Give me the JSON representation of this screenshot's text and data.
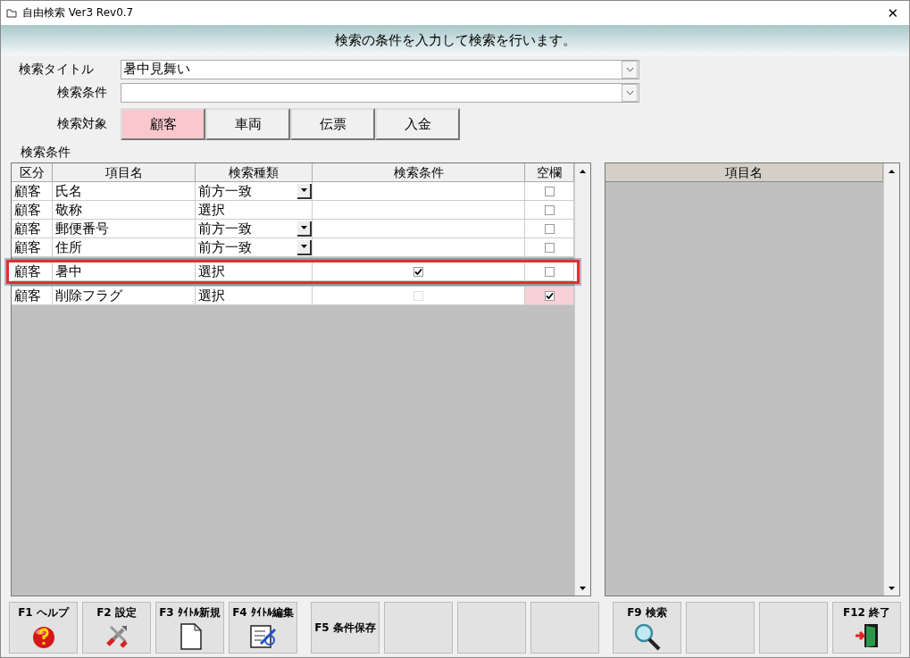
{
  "window": {
    "title": "自由検索 Ver3 Rev0.7",
    "close": "✕"
  },
  "banner": "検索の条件を入力して検索を行います。",
  "form": {
    "title_label": "検索タイトル",
    "title_value": "暑中見舞い",
    "condition_label": "検索条件",
    "target_label": "検索対象"
  },
  "targets": [
    {
      "label": "顧客",
      "selected": true
    },
    {
      "label": "車両",
      "selected": false
    },
    {
      "label": "伝票",
      "selected": false
    },
    {
      "label": "入金",
      "selected": false
    }
  ],
  "grid_label": "検索条件",
  "grid": {
    "columns": [
      "区分",
      "項目名",
      "検索種類",
      "検索条件",
      "空欄"
    ],
    "rows": [
      {
        "kind": "text",
        "category": "顧客",
        "item": "氏名",
        "type": "前方一致",
        "dropdown": true,
        "blank_checked": false,
        "highlighted": false
      },
      {
        "kind": "plain",
        "category": "顧客",
        "item": "敬称",
        "type": "選択",
        "dropdown": false,
        "blank_checked": false,
        "highlighted": false
      },
      {
        "kind": "text",
        "category": "顧客",
        "item": "郵便番号",
        "type": "前方一致",
        "dropdown": true,
        "blank_checked": false,
        "highlighted": false
      },
      {
        "kind": "text",
        "category": "顧客",
        "item": "住所",
        "type": "前方一致",
        "dropdown": true,
        "blank_checked": false,
        "highlighted": false
      },
      {
        "kind": "checkbox",
        "category": "顧客",
        "item": "暑中",
        "type": "選択",
        "dropdown": false,
        "condition_checked": true,
        "condition_disabled": false,
        "blank_checked": false,
        "highlighted": true
      },
      {
        "kind": "checkbox",
        "category": "顧客",
        "item": "削除フラグ",
        "type": "選択",
        "dropdown": false,
        "condition_checked": false,
        "condition_disabled": true,
        "blank_checked": true,
        "highlighted": false
      }
    ]
  },
  "side_panel": {
    "column": "項目名"
  },
  "function_keys": [
    {
      "kind": "help",
      "label": "F1 ヘルプ"
    },
    {
      "kind": "tools",
      "label": "F2 設定"
    },
    {
      "kind": "new",
      "label": "F3 ﾀｲﾄﾙ新規"
    },
    {
      "kind": "edit",
      "label": "F4 ﾀｲﾄﾙ編集"
    },
    {
      "kind": "plain",
      "label": "F5 条件保存"
    },
    {
      "kind": "blank"
    },
    {
      "kind": "blank"
    },
    {
      "kind": "blank"
    },
    {
      "kind": "search",
      "label": "F9 検索"
    },
    {
      "kind": "blank"
    },
    {
      "kind": "blank"
    },
    {
      "kind": "exit",
      "label": "F12 終了"
    }
  ]
}
